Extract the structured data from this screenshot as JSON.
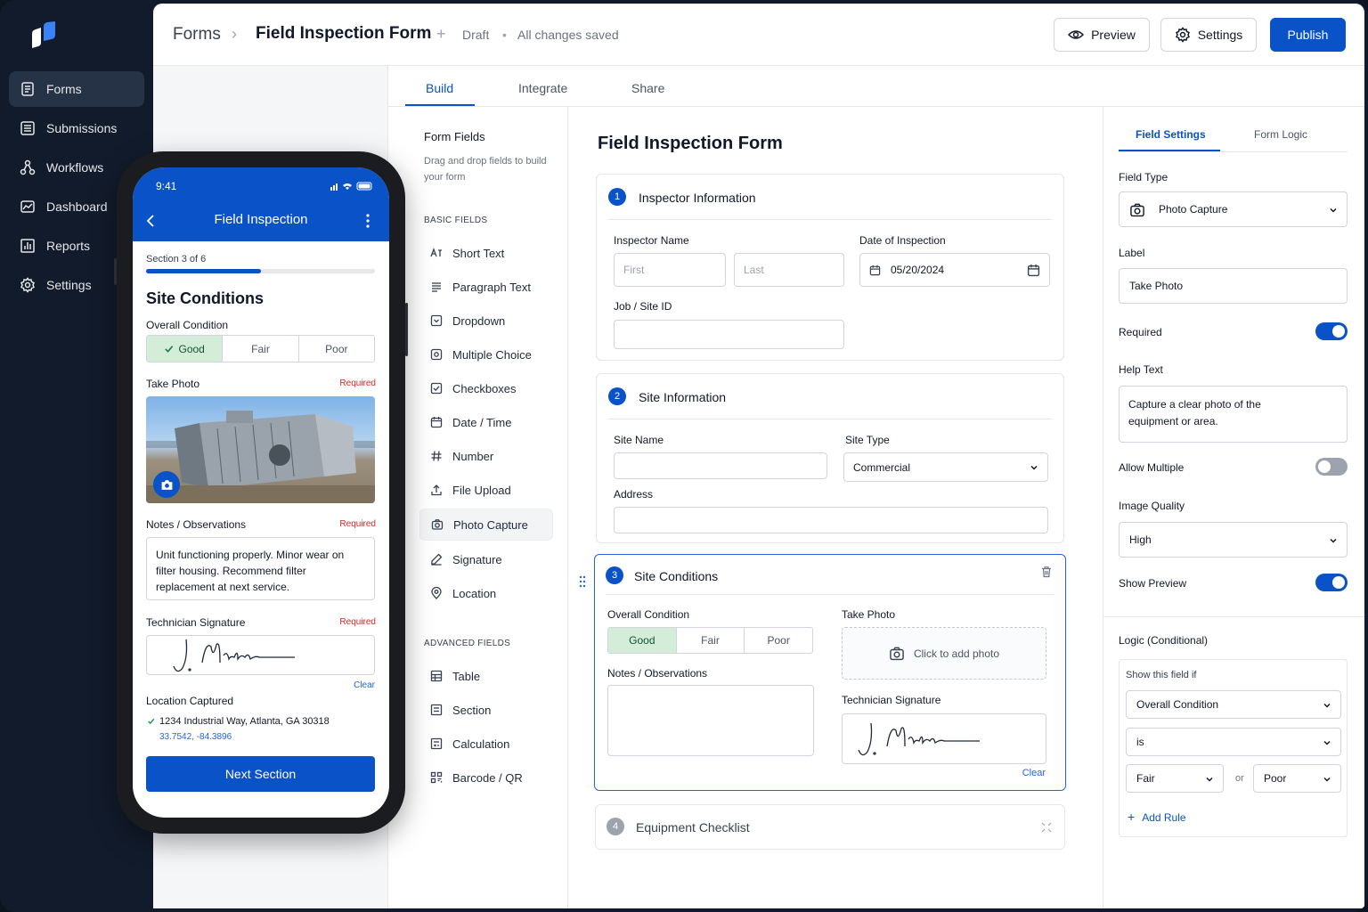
{
  "nav": {
    "items": [
      {
        "label": "Forms",
        "icon": "forms-icon",
        "active": true
      },
      {
        "label": "Submissions",
        "icon": "list-icon",
        "active": false
      },
      {
        "label": "Workflows",
        "icon": "workflow-icon",
        "active": false
      },
      {
        "label": "Dashboard",
        "icon": "dashboard-icon",
        "active": false
      },
      {
        "label": "Reports",
        "icon": "reports-icon",
        "active": false
      },
      {
        "label": "Settings",
        "icon": "gear-icon",
        "active": false
      }
    ]
  },
  "header": {
    "crumb": "Forms",
    "sep": "›",
    "title": "Field Inspection Form",
    "plus": "+",
    "status": "Draft",
    "dot": "•",
    "saved": "All changes saved",
    "preview": "Preview",
    "settings": "Settings",
    "publish": "Publish"
  },
  "tabs": [
    "Build",
    "Integrate",
    "Share"
  ],
  "palette": {
    "title": "Form Fields",
    "subtitle": "Drag and drop fields to build your form",
    "basic_heading": "BASIC FIELDS",
    "basic": [
      "Short Text",
      "Paragraph Text",
      "Dropdown",
      "Multiple Choice",
      "Checkboxes",
      "Date / Time",
      "Number",
      "File Upload",
      "Photo Capture",
      "Signature",
      "Location"
    ],
    "advanced_heading": "ADVANCED FIELDS",
    "advanced": [
      "Table",
      "Section",
      "Calculation",
      "Barcode / QR"
    ]
  },
  "canvas": {
    "title": "Field Inspection Form",
    "s1": {
      "num": "1",
      "title": "Inspector Information",
      "name_label": "Inspector Name",
      "first_ph": "First",
      "last_ph": "Last",
      "date_label": "Date of Inspection",
      "date_value": "05/20/2024",
      "job_label": "Job / Site ID"
    },
    "s2": {
      "num": "2",
      "title": "Site Information",
      "site_name_label": "Site Name",
      "site_type_label": "Site Type",
      "site_type_value": "Commercial",
      "address_label": "Address"
    },
    "s3": {
      "num": "3",
      "title": "Site Conditions",
      "overall_label": "Overall Condition",
      "options": [
        "Good",
        "Fair",
        "Poor"
      ],
      "selected": "Good",
      "photo_label": "Take Photo",
      "photo_hint": "Click to add photo",
      "notes_label": "Notes / Observations",
      "sig_label": "Technician Signature",
      "clear": "Clear"
    },
    "s4": {
      "num": "4",
      "title": "Equipment Checklist"
    }
  },
  "right": {
    "tab_field": "Field Settings",
    "tab_logic": "Form Logic",
    "type_label": "Field Type",
    "type_value": "Photo Capture",
    "label_label": "Label",
    "label_value": "Take Photo",
    "required_label": "Required",
    "required": true,
    "help_label": "Help Text",
    "help_value": "Capture a clear photo of the equipment or area.",
    "multiple_label": "Allow Multiple",
    "multiple": false,
    "quality_label": "Image Quality",
    "quality_value": "High",
    "preview_label": "Show Preview",
    "preview": true,
    "logic_label": "Logic (Conditional)",
    "show_if": "Show this field if",
    "cond_field": "Overall Condition",
    "cond_op": "is",
    "cond_v1": "Fair",
    "or": "or",
    "cond_v2": "Poor",
    "add_rule": "Add Rule",
    "add_plus": "+"
  },
  "phone": {
    "time": "9:41",
    "title": "Field Inspection",
    "section": "Section 3 of 6",
    "progress": 0.5,
    "heading": "Site Conditions",
    "overall_label": "Overall Condition",
    "options": [
      "Good",
      "Fair",
      "Poor"
    ],
    "photo_label": "Take Photo",
    "required": "Required",
    "notes_label": "Notes / Observations",
    "notes_value": "Unit functioning properly. Minor wear on filter housing. Recommend filter replacement at next service.",
    "sig_label": "Technician Signature",
    "clear": "Clear",
    "loc_label": "Location Captured",
    "address": "1234 Industrial Way, Atlanta, GA 30318",
    "coords": "33.7542, -84.3896",
    "next": "Next Section"
  },
  "colors": {
    "accent": "#0a52c7",
    "sidebar": "#121b2b",
    "good": "#d4edd8",
    "required": "#dc2626"
  }
}
